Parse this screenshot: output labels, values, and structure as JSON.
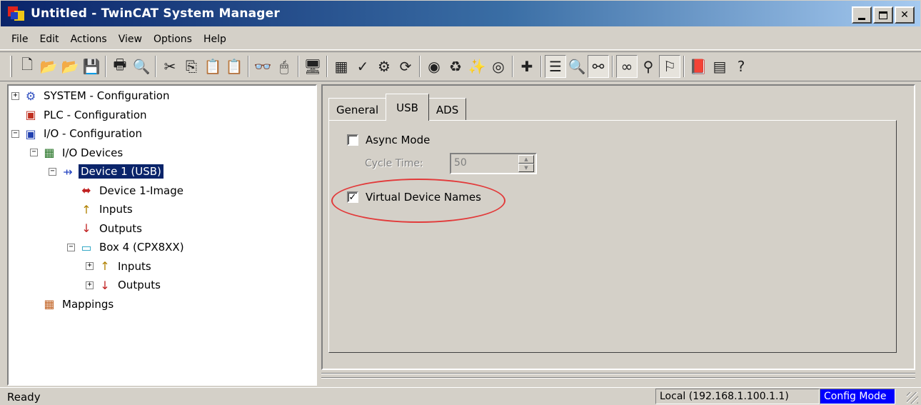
{
  "window": {
    "title": "Untitled - TwinCAT System Manager",
    "minimize_icon": "minimize-icon",
    "maximize_icon": "maximize-icon",
    "close_label": "✕"
  },
  "menu": [
    "File",
    "Edit",
    "Actions",
    "View",
    "Options",
    "Help"
  ],
  "toolbar": {
    "icons": [
      {
        "name": "new-icon",
        "glyph": "🗋"
      },
      {
        "name": "open-icon",
        "glyph": "📂"
      },
      {
        "name": "open-from-target-icon",
        "glyph": "📂"
      },
      {
        "name": "save-icon",
        "glyph": "💾"
      },
      {
        "sep": true
      },
      {
        "name": "print-icon",
        "glyph": "🖶"
      },
      {
        "name": "print-preview-icon",
        "glyph": "🔍"
      },
      {
        "sep": true
      },
      {
        "name": "cut-icon",
        "glyph": "✂"
      },
      {
        "name": "copy-icon",
        "glyph": "⎘"
      },
      {
        "name": "paste-icon",
        "glyph": "📋"
      },
      {
        "name": "paste-with-links-icon",
        "glyph": "📋"
      },
      {
        "sep": true
      },
      {
        "name": "find-icon",
        "glyph": "👓"
      },
      {
        "name": "mouse-icon",
        "glyph": "🖱"
      },
      {
        "sep": true
      },
      {
        "name": "monitor-icon",
        "glyph": "🖥"
      },
      {
        "sep": true
      },
      {
        "name": "generate-mappings-icon",
        "glyph": "▦"
      },
      {
        "name": "check-configuration-icon",
        "glyph": "✓"
      },
      {
        "name": "activate-configuration-icon",
        "glyph": "⚙"
      },
      {
        "name": "restart-config-mode-icon",
        "glyph": "⟳"
      },
      {
        "sep": true
      },
      {
        "name": "set-run-mode-icon",
        "glyph": "◉"
      },
      {
        "name": "reload-devices-icon",
        "glyph": "♻"
      },
      {
        "name": "scan-devices-icon",
        "glyph": "✨"
      },
      {
        "name": "toggle-free-run-icon",
        "glyph": "◎"
      },
      {
        "sep": true
      },
      {
        "name": "append-device-icon",
        "glyph": "✚"
      },
      {
        "sep": true
      },
      {
        "name": "show-sub-items-icon",
        "glyph": "☰",
        "pressed": true
      },
      {
        "name": "zoom-icon",
        "glyph": "🔍"
      },
      {
        "name": "show-online-data-icon",
        "glyph": "⚯",
        "pressed": true
      },
      {
        "sep": true
      },
      {
        "name": "online-view-icon",
        "glyph": "∞",
        "pressed": true
      },
      {
        "name": "connect-icon",
        "glyph": "⚲"
      },
      {
        "name": "io-info-icon",
        "glyph": "⚐",
        "pressed": true
      },
      {
        "sep": true
      },
      {
        "name": "book-icon",
        "glyph": "📕"
      },
      {
        "name": "calculator-icon",
        "glyph": "▤"
      },
      {
        "name": "help-icon",
        "glyph": "?"
      }
    ]
  },
  "tree": [
    {
      "label": "SYSTEM - Configuration",
      "icon": "system-config-icon",
      "depth": 0,
      "expander": "+"
    },
    {
      "label": "PLC - Configuration",
      "icon": "plc-config-icon",
      "depth": 0,
      "expander": ""
    },
    {
      "label": "I/O - Configuration",
      "icon": "io-config-icon",
      "depth": 0,
      "expander": "-"
    },
    {
      "label": "I/O Devices",
      "icon": "io-devices-icon",
      "depth": 1,
      "expander": "-"
    },
    {
      "label": "Device 1 (USB)",
      "icon": "usb-device-icon",
      "depth": 2,
      "expander": "-",
      "selected": true
    },
    {
      "label": "Device 1-Image",
      "icon": "device-image-icon",
      "depth": 3,
      "expander": ""
    },
    {
      "label": "Inputs",
      "icon": "inputs-icon",
      "depth": 3,
      "expander": ""
    },
    {
      "label": "Outputs",
      "icon": "outputs-icon",
      "depth": 3,
      "expander": ""
    },
    {
      "label": "Box 4 (CPX8XX)",
      "icon": "box-icon",
      "depth": 3,
      "expander": "-"
    },
    {
      "label": "Inputs",
      "icon": "inputs-icon",
      "depth": 4,
      "expander": "+"
    },
    {
      "label": "Outputs",
      "icon": "outputs-icon",
      "depth": 4,
      "expander": "+"
    },
    {
      "label": "Mappings",
      "icon": "mappings-icon",
      "depth": 1,
      "expander": ""
    }
  ],
  "tabs": [
    {
      "label": "General",
      "active": false
    },
    {
      "label": "USB",
      "active": true
    },
    {
      "label": "ADS",
      "active": false
    }
  ],
  "usb": {
    "async_mode_label": "Async Mode",
    "async_mode_checked": false,
    "cycle_time_label": "Cycle Time:",
    "cycle_time_value": "50",
    "virtual_names_label": "Virtual Device Names",
    "virtual_names_checked": true,
    "highlight_color": "#e23a3a"
  },
  "status": {
    "text": "Ready",
    "target": "Local (192.168.1.100.1.1)",
    "mode": "Config Mode",
    "mode_color": "#0000ff"
  }
}
